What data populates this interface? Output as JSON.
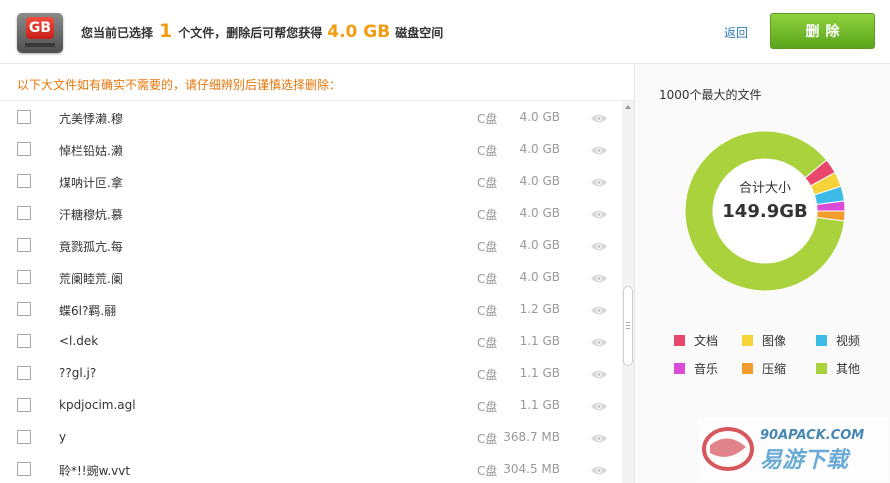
{
  "header": {
    "badge": "GB",
    "summary_prefix": "您当前已选择",
    "selected_count": "1",
    "summary_mid": "个文件，删除后可帮您获得",
    "free_space": "4.0 GB",
    "summary_suffix": "磁盘空间",
    "back_label": "返回",
    "delete_label": "删除"
  },
  "list": {
    "hint": "以下大文件如有确实不需要的，请仔细辨别后谨慎选择删除：",
    "files": [
      {
        "name": "亢美悸濑.穆",
        "drive": "C盘",
        "size": "4.0 GB"
      },
      {
        "name": "悼栏铅姑.濑",
        "drive": "C盘",
        "size": "4.0 GB"
      },
      {
        "name": "煤呐计叵.拿",
        "drive": "C盘",
        "size": "4.0 GB"
      },
      {
        "name": "汗糖穆炕.慕",
        "drive": "C盘",
        "size": "4.0 GB"
      },
      {
        "name": "竟戮孤亢.每",
        "drive": "C盘",
        "size": "4.0 GB"
      },
      {
        "name": "荒阑睦荒.阑",
        "drive": "C盘",
        "size": "4.0 GB"
      },
      {
        "name": "蝶6l?羁.翮",
        "drive": "C盘",
        "size": "1.2 GB"
      },
      {
        "name": "<l.dek",
        "drive": "C盘",
        "size": "1.1 GB"
      },
      {
        "name": "??gl.j?",
        "drive": "C盘",
        "size": "1.1 GB"
      },
      {
        "name": "kpdjocim.agl",
        "drive": "C盘",
        "size": "1.1 GB"
      },
      {
        "name": "y",
        "drive": "C盘",
        "size": "368.7 MB"
      },
      {
        "name": "聆*!!豌w.vvt",
        "drive": "C盘",
        "size": "304.5 MB"
      }
    ]
  },
  "summary_panel": {
    "title": "1000个最大的文件",
    "total_label": "合计大小",
    "total_value": "149.9GB",
    "legend": [
      {
        "label": "文档",
        "color": "#e8466b"
      },
      {
        "label": "图像",
        "color": "#f7d33a"
      },
      {
        "label": "视频",
        "color": "#3dbbe8"
      },
      {
        "label": "音乐",
        "color": "#d94bd6"
      },
      {
        "label": "压缩",
        "color": "#f39c2e"
      },
      {
        "label": "其他",
        "color": "#a9d23c"
      }
    ],
    "shares": [
      {
        "label": "文档",
        "fraction": 0.03
      },
      {
        "label": "图像",
        "fraction": 0.03
      },
      {
        "label": "视频",
        "fraction": 0.03
      },
      {
        "label": "音乐",
        "fraction": 0.02
      },
      {
        "label": "压缩",
        "fraction": 0.02
      },
      {
        "label": "其他",
        "fraction": 0.87
      }
    ]
  },
  "watermark": {
    "top_text": "90APACK.COM",
    "bottom_text": "易游下载"
  }
}
